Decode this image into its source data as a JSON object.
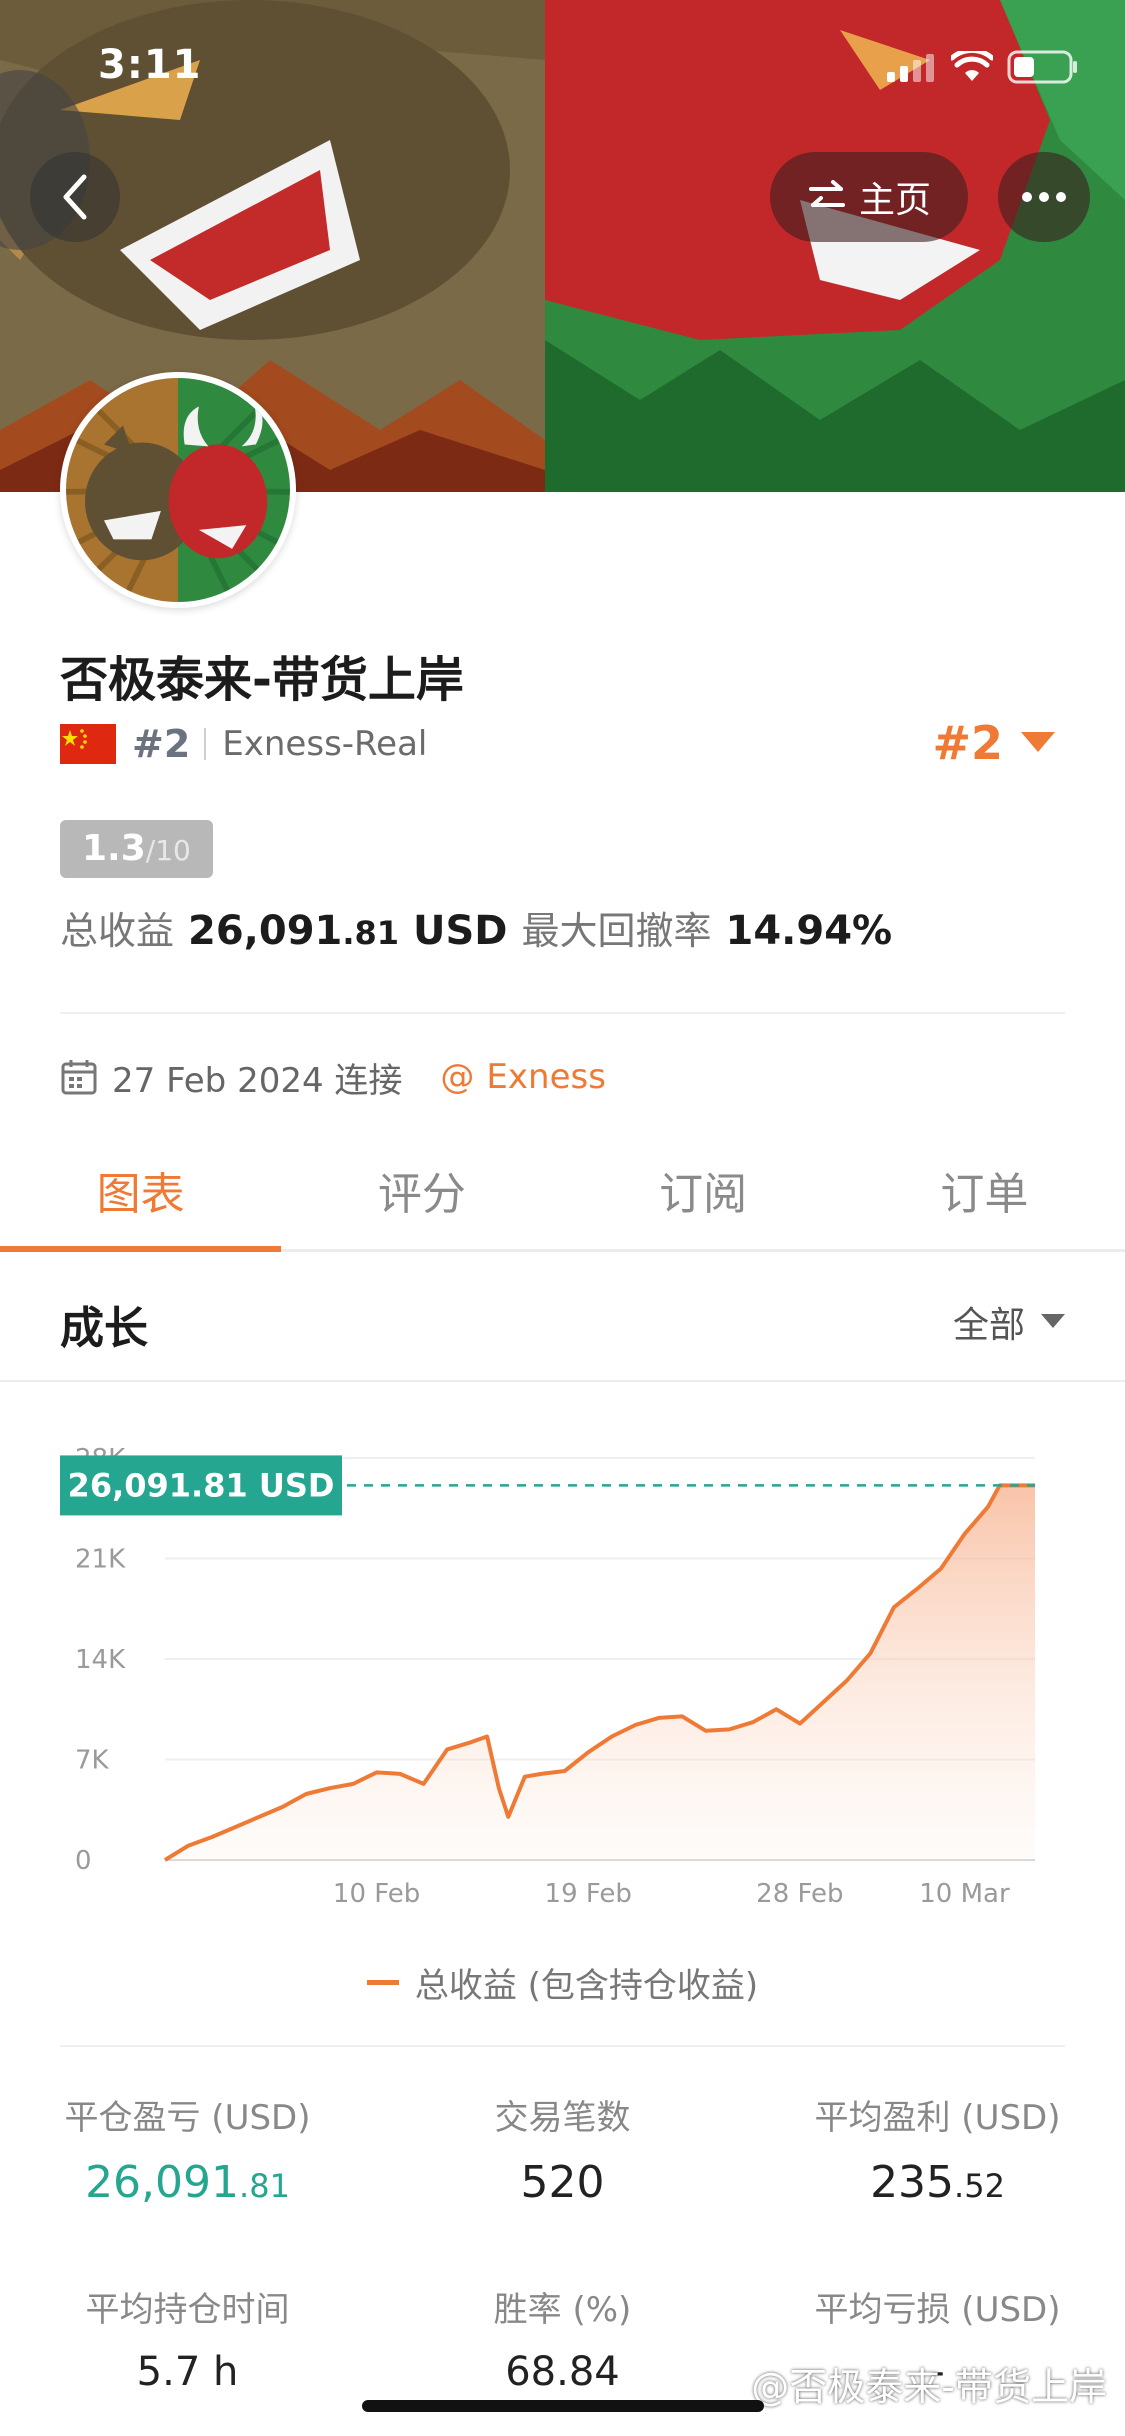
{
  "status_bar": {
    "time": "3:11"
  },
  "header": {
    "home_label": "主页"
  },
  "profile": {
    "name": "否极泰来-带货上岸",
    "rank_small": "#2",
    "broker_account": "Exness-Real",
    "rank_big": "#2",
    "score": "1.3",
    "score_max": "/10",
    "total_profit_label": "总收益",
    "total_profit_value_main": "26,091",
    "total_profit_value_dec": ".81",
    "total_profit_unit": "USD",
    "drawdown_label": "最大回撤率",
    "drawdown_value": "14.94%",
    "connected_date": "27 Feb 2024 连接",
    "broker_link": "Exness"
  },
  "tabs": [
    {
      "label": "图表",
      "active": true
    },
    {
      "label": "评分",
      "active": false
    },
    {
      "label": "订阅",
      "active": false
    },
    {
      "label": "订单",
      "active": false
    }
  ],
  "growth": {
    "title": "成长",
    "filter_label": "全部"
  },
  "chart_data": {
    "type": "area",
    "current_label": "26,091.81 USD",
    "y_ticks": [
      "0",
      "7K",
      "14K",
      "21K",
      "28K"
    ],
    "ylim": [
      0,
      28000
    ],
    "x_ticks": [
      {
        "label": "10 Feb",
        "x": 10
      },
      {
        "label": "19 Feb",
        "x": 19
      },
      {
        "label": "28 Feb",
        "x": 28
      },
      {
        "label": "10 Mar",
        "x": 35
      }
    ],
    "xlim": [
      1,
      38
    ],
    "series": [
      {
        "name": "总收益 (包含持仓收益)",
        "points": [
          [
            1,
            0
          ],
          [
            2,
            1000
          ],
          [
            3,
            1600
          ],
          [
            4,
            2300
          ],
          [
            5,
            3000
          ],
          [
            6,
            3700
          ],
          [
            7,
            4600
          ],
          [
            8,
            5000
          ],
          [
            9,
            5300
          ],
          [
            10,
            6100
          ],
          [
            11,
            6000
          ],
          [
            12,
            5300
          ],
          [
            13,
            7700
          ],
          [
            14,
            8200
          ],
          [
            14.7,
            8600
          ],
          [
            15.2,
            5000
          ],
          [
            15.6,
            3000
          ],
          [
            16.3,
            5800
          ],
          [
            17,
            6000
          ],
          [
            18,
            6200
          ],
          [
            19,
            7500
          ],
          [
            20,
            8600
          ],
          [
            21,
            9400
          ],
          [
            22,
            9900
          ],
          [
            23,
            10000
          ],
          [
            24,
            9000
          ],
          [
            25,
            9100
          ],
          [
            26,
            9600
          ],
          [
            27,
            10500
          ],
          [
            28,
            9500
          ],
          [
            29,
            11000
          ],
          [
            30,
            12500
          ],
          [
            31,
            14400
          ],
          [
            32,
            17600
          ],
          [
            33,
            18900
          ],
          [
            34,
            20300
          ],
          [
            35,
            22700
          ],
          [
            36,
            24600
          ],
          [
            36.5,
            26091.81
          ],
          [
            38,
            26091.81
          ]
        ]
      }
    ]
  },
  "legend_label": "总收益 (包含持仓收益)",
  "stats": [
    {
      "label": "平仓盈亏 (USD)",
      "main": "26,091",
      "dec": ".81",
      "green": true
    },
    {
      "label": "交易笔数",
      "main": "520",
      "dec": "",
      "green": false
    },
    {
      "label": "平均盈利 (USD)",
      "main": "235",
      "dec": ".52",
      "green": false
    },
    {
      "label": "平均持仓时间",
      "main": "5.7 h",
      "dec": "",
      "green": false
    },
    {
      "label": "胜率 (%)",
      "main": "68.84",
      "dec": "",
      "green": false
    },
    {
      "label": "平均亏损 (USD)",
      "main": "-",
      "dec": "",
      "green": false
    }
  ],
  "watermark": "@否极泰来-带货上岸",
  "colors": {
    "accent": "#ef7a35",
    "teal": "#25a691"
  }
}
